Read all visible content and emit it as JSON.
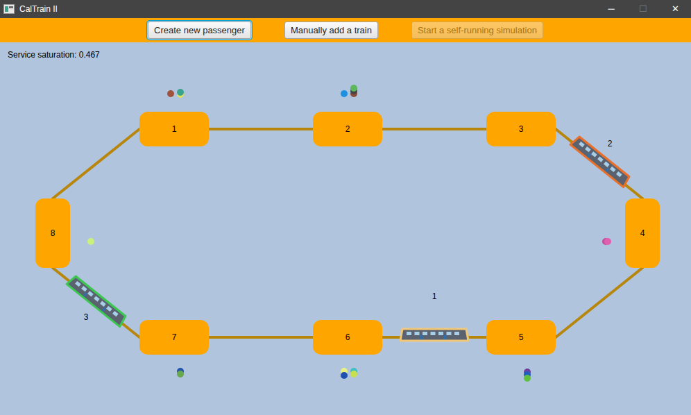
{
  "window": {
    "title": "CalTrain II",
    "controls": [
      {
        "label": "─",
        "disabled": false
      },
      {
        "label": "☐",
        "disabled": true
      },
      {
        "label": "✕",
        "disabled": false
      }
    ]
  },
  "toolbar": {
    "buttons": [
      {
        "label": "Create new passenger",
        "focused": true,
        "disabled": false
      },
      {
        "label": "Manually add a train",
        "focused": false,
        "disabled": false
      },
      {
        "label": "Start a self-running simulation",
        "focused": false,
        "disabled": true
      }
    ]
  },
  "status": {
    "saturation": "Service saturation: 0.467"
  },
  "stations": [
    {
      "label": "1",
      "passengers": [
        {
          "color": "#a0523c"
        },
        {
          "color": "#e0e060"
        },
        {
          "color": "#3aa38f"
        }
      ]
    },
    {
      "label": "2",
      "passengers": [
        {
          "color": "#1e90e0"
        },
        {
          "color": "#8b4a3a"
        },
        {
          "color": "#444444"
        },
        {
          "color": "#5cb85c"
        }
      ]
    },
    {
      "label": "3",
      "passengers": []
    },
    {
      "label": "4",
      "passengers": [
        {
          "color": "#c050a0"
        },
        {
          "color": "#e060b0"
        }
      ]
    },
    {
      "label": "5",
      "passengers": [
        {
          "color": "#7040a0"
        },
        {
          "color": "#2060c0"
        },
        {
          "color": "#60c040"
        }
      ]
    },
    {
      "label": "6",
      "passengers": [
        {
          "color": "#e8f080"
        },
        {
          "color": "#40c0c0"
        },
        {
          "color": "#2050b0"
        },
        {
          "color": "#c8e050"
        }
      ]
    },
    {
      "label": "7",
      "passengers": [
        {
          "color": "#2255aa"
        },
        {
          "color": "#6aa84f"
        }
      ]
    },
    {
      "label": "8",
      "passengers": [
        {
          "color": "#c8f07a"
        }
      ]
    }
  ],
  "trains": [
    {
      "label": "1",
      "color": "#f0c878"
    },
    {
      "label": "2",
      "color": "#e8702a"
    },
    {
      "label": "3",
      "color": "#3cc850"
    }
  ]
}
